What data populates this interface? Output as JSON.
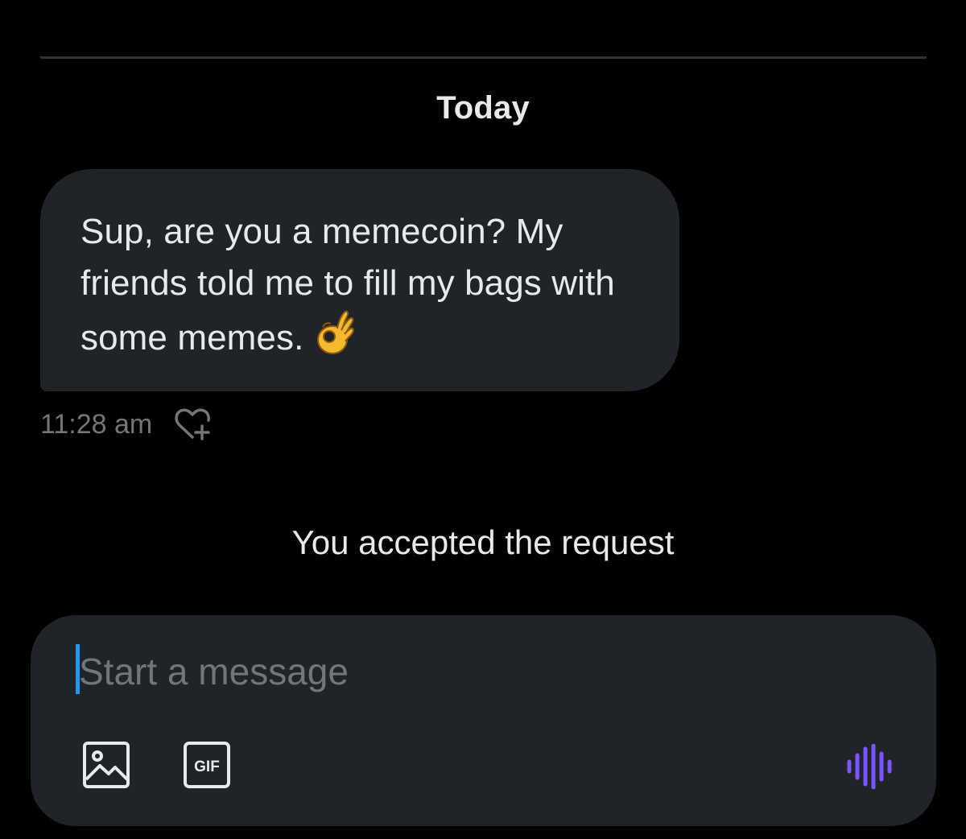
{
  "conversation": {
    "date_header": "Today",
    "messages": [
      {
        "text": "Sup, are you a memecoin? My friends told me to fill my bags with some memes.",
        "emoji": "ok-hand-emoji",
        "time": "11:28 am"
      }
    ],
    "system_note": "You accepted the request"
  },
  "composer": {
    "placeholder": "Start a message",
    "value": ""
  },
  "icons": {
    "react": "heart-plus-icon",
    "image": "image-icon",
    "gif": "gif-icon",
    "gif_label": "GIF",
    "voice": "voice-waveform-icon"
  },
  "colors": {
    "background": "#000000",
    "bubble": "#202327",
    "text": "#e7e9ea",
    "muted": "#71767b",
    "accent_blue": "#1d9bf0",
    "voice_purple": "#7856ff"
  }
}
